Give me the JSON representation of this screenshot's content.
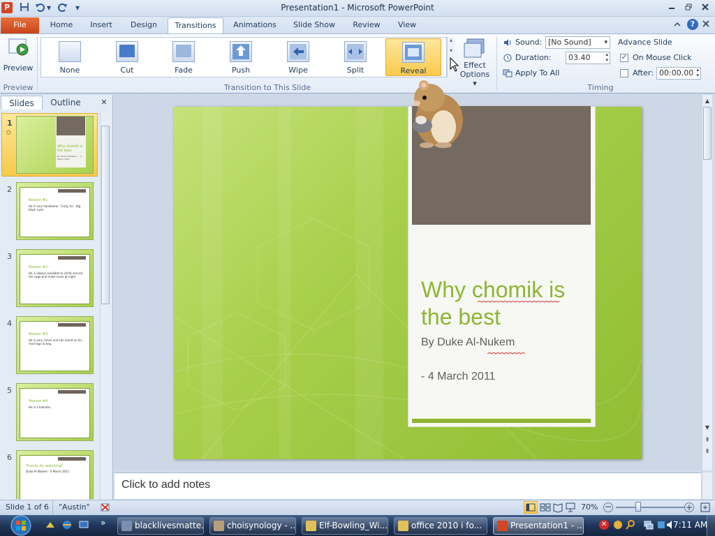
{
  "window": {
    "title": "Presentation1 - Microsoft PowerPoint",
    "app_icon_letter": "P",
    "qat_more": "▾"
  },
  "tabs": [
    {
      "label": "File"
    },
    {
      "label": "Home"
    },
    {
      "label": "Insert"
    },
    {
      "label": "Design"
    },
    {
      "label": "Transitions"
    },
    {
      "label": "Animations"
    },
    {
      "label": "Slide Show"
    },
    {
      "label": "Review"
    },
    {
      "label": "View"
    }
  ],
  "active_tab": "Transitions",
  "ribbon": {
    "preview": {
      "label": "Preview",
      "group": "Preview"
    },
    "gallery_group": "Transition to This Slide",
    "transitions": [
      {
        "label": "None"
      },
      {
        "label": "Cut"
      },
      {
        "label": "Fade"
      },
      {
        "label": "Push"
      },
      {
        "label": "Wipe"
      },
      {
        "label": "Split"
      },
      {
        "label": "Reveal"
      }
    ],
    "selected_transition": "Reveal",
    "effect_options": {
      "line1": "Effect",
      "line2": "Options ▾"
    },
    "timing": {
      "group": "Timing",
      "sound_label": "Sound:",
      "sound_value": "[No Sound]",
      "duration_label": "Duration:",
      "duration_value": "03.40",
      "apply_all": "Apply To All",
      "advance_label": "Advance Slide",
      "on_click_label": "On Mouse Click",
      "on_click_checked": true,
      "after_label": "After:",
      "after_checked": false,
      "after_value": "00:00.00"
    }
  },
  "left_pane": {
    "tabs": {
      "slides": "Slides",
      "outline": "Outline",
      "close": "✕"
    },
    "slides": [
      {
        "num": "1",
        "title": "Why chomik is the best",
        "body": "By Duke Al-Nukem · - 4 March 2011"
      },
      {
        "num": "2",
        "title": "Reason #1",
        "body": "He is very handsome · Fuzzy fur · Big black eyes"
      },
      {
        "num": "3",
        "title": "Reason #2",
        "body": "He is always available to climb around the cage and make noise at night"
      },
      {
        "num": "4",
        "title": "Reason #3",
        "body": "He is very clever and can stand on his hind legs to beg"
      },
      {
        "num": "5",
        "title": "Reason #4",
        "body": "He is a hamster"
      },
      {
        "num": "6",
        "title": "Thanks for watching!",
        "body": "Duke Al-Nukem · 4 March 2011"
      }
    ]
  },
  "slide": {
    "title": "Why chomik is the best",
    "subtitle": "By Duke Al-Nukem",
    "date": "- 4 March 2011"
  },
  "notes": {
    "placeholder": "Click to add notes"
  },
  "status": {
    "slide_info": "Slide 1 of 6",
    "theme": "\"Austin\"",
    "zoom": "70%"
  },
  "taskbar": {
    "items": [
      {
        "label": "blacklivesmatte..."
      },
      {
        "label": "choisynology - ..."
      },
      {
        "label": "Elf-Bowling_Wi..."
      },
      {
        "label": "office 2010 i fo..."
      },
      {
        "label": "Presentation1 - ..."
      }
    ],
    "clock": "7:11 AM"
  },
  "colors": {
    "accent_green": "#8eb533",
    "photo_brown": "#746a60",
    "file_tab": "#d24625",
    "selected_gallery": "#fbc94e"
  }
}
